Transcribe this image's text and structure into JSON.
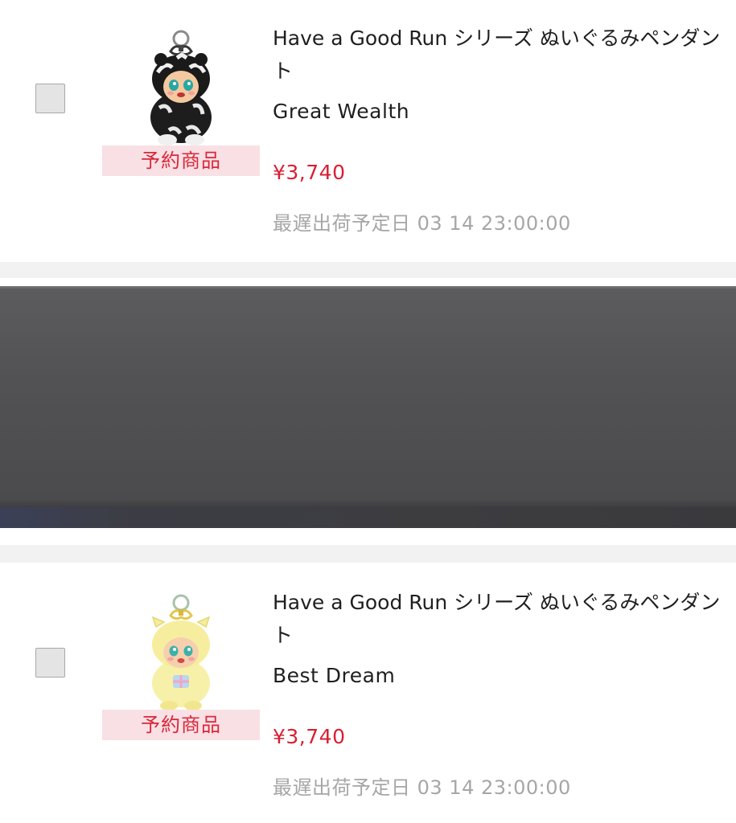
{
  "items": [
    {
      "title": "Have a Good Run シリーズ ぬいぐるみペンダント",
      "variant": "Great Wealth",
      "badge": "予約商品",
      "price": "¥3,740",
      "ship_label": "最遅出荷予定日 03 14 23:00:00",
      "thumb_icon": "black-white-tiger-plush-keychain",
      "checked": false
    },
    {
      "title": "Have a Good Run シリーズ ぬいぐるみペンダント",
      "variant": "Best Dream",
      "badge": "予約商品",
      "price": "¥3,740",
      "ship_label": "最遅出荷予定日 03 14 23:00:00",
      "thumb_icon": "yellow-pig-plush-keychain",
      "checked": false
    }
  ],
  "colors": {
    "price": "#d81f33",
    "badge_bg": "#f9e0e4",
    "badge_text": "#d9283b",
    "muted_text": "#a6a6a6",
    "separator": "#f2f2f2",
    "overlay_panel": "#525254"
  }
}
